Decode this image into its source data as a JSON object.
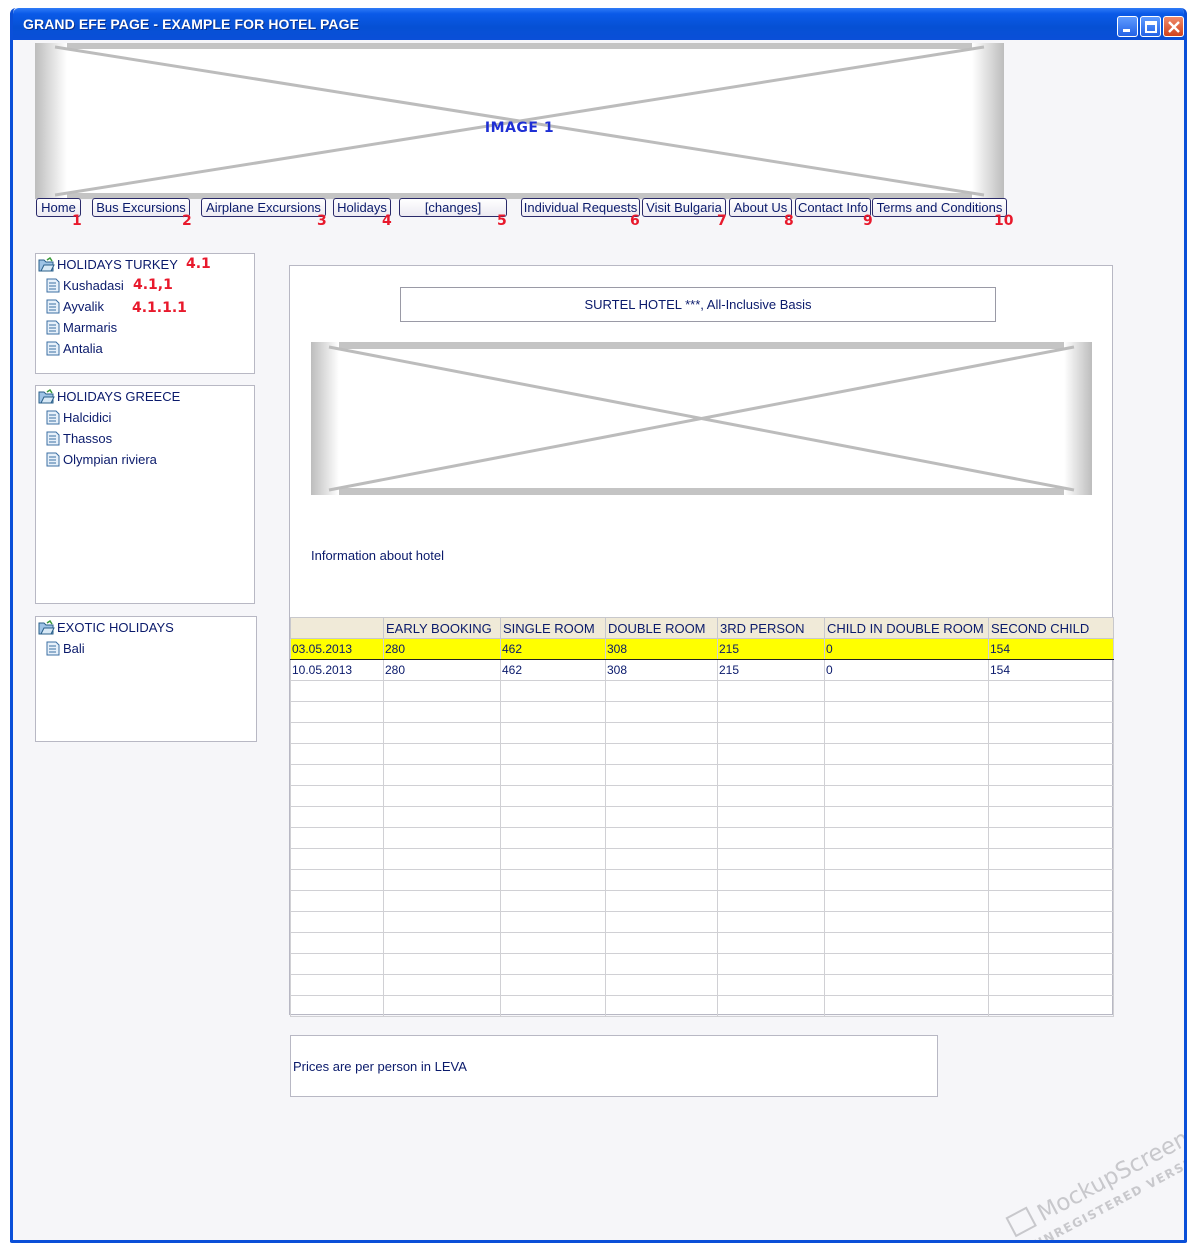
{
  "window": {
    "title": "GRAND EFE PAGE - EXAMPLE FOR HOTEL PAGE"
  },
  "hero": {
    "label": "IMAGE 1"
  },
  "nav": [
    {
      "label": "Home",
      "num": "1"
    },
    {
      "label": "Bus Excursions",
      "num": "2"
    },
    {
      "label": "Airplane Excursions",
      "num": "3"
    },
    {
      "label": "Holidays",
      "num": "4"
    },
    {
      "label": "[changes]",
      "num": "5"
    },
    {
      "label": "Individual Requests",
      "num": "6"
    },
    {
      "label": "Visit Bulgaria",
      "num": "7"
    },
    {
      "label": "About Us",
      "num": "8"
    },
    {
      "label": "Contact Info",
      "num": "9"
    },
    {
      "label": "Terms and Conditions",
      "num": "10"
    }
  ],
  "sidebar": {
    "turkey": {
      "title": "HOLIDAYS TURKEY",
      "title_num": "4.1",
      "items": [
        {
          "label": "Kushadasi",
          "num": "4.1,1"
        },
        {
          "label": "Ayvalik",
          "num": "4.1.1.1"
        },
        {
          "label": "Marmaris"
        },
        {
          "label": "Antalia"
        }
      ]
    },
    "greece": {
      "title": "HOLIDAYS GREECE",
      "items": [
        {
          "label": "Halcidici"
        },
        {
          "label": "Thassos"
        },
        {
          "label": "Olympian riviera"
        }
      ]
    },
    "exotic": {
      "title": "EXOTIC HOLIDAYS",
      "items": [
        {
          "label": "Bali"
        }
      ]
    }
  },
  "hotel": {
    "title": "SURTEL HOTEL ***, All-Inclusive Basis",
    "info": "Information about hotel"
  },
  "table": {
    "headers": [
      "",
      "EARLY BOOKING",
      "SINGLE ROOM",
      "DOUBLE ROOM",
      "3RD PERSON",
      "CHILD IN DOUBLE ROOM",
      "SECOND  CHILD"
    ],
    "rows": [
      [
        "03.05.2013",
        "280",
        "462",
        "308",
        "215",
        "0",
        "154"
      ],
      [
        "10.05.2013",
        "280",
        "462",
        "308",
        "215",
        "0",
        "154"
      ]
    ],
    "highlight_color": "#ffff00"
  },
  "note": {
    "text": "Prices are per person in LEVA"
  },
  "watermark": {
    "line1": "MockupScreens",
    "line2": "UNREGISTERED VERSION"
  }
}
